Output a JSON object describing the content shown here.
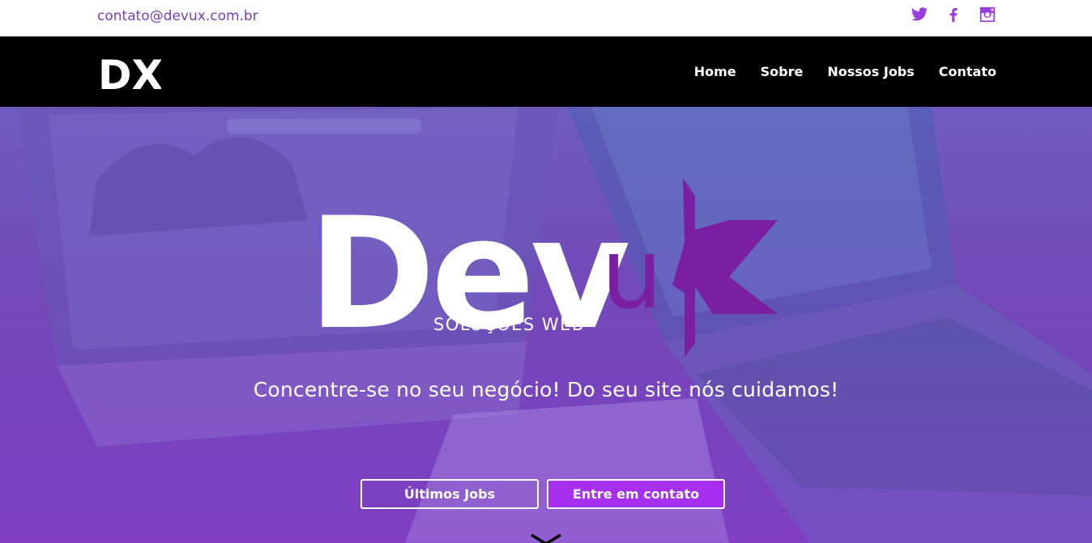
{
  "topbar": {
    "email": "contato@devux.com.br",
    "social": [
      {
        "icon": "twitter-icon"
      },
      {
        "icon": "facebook-icon"
      },
      {
        "icon": "instagram-icon"
      }
    ]
  },
  "nav": {
    "logo_text": "DX",
    "items": [
      {
        "label": "Home"
      },
      {
        "label": "Sobre"
      },
      {
        "label": "Nossos Jobs"
      },
      {
        "label": "Contato"
      }
    ]
  },
  "hero": {
    "brand_main": "Dev",
    "brand_accent": "u",
    "brand_x": "X",
    "brand_sub": "SOLUÇÕES WEB",
    "tagline": "Concentre-se no seu negócio! Do seu site nós cuidamos!",
    "buttons": {
      "jobs": "Últimos Jobs",
      "contact": "Entre em contato"
    },
    "scroll_icon": "chevron-down-icon"
  },
  "colors": {
    "accent": "#a62ff0",
    "email": "#7a3cb8",
    "social": "#9a3ee0",
    "brand_purple": "#7b1fa2"
  }
}
